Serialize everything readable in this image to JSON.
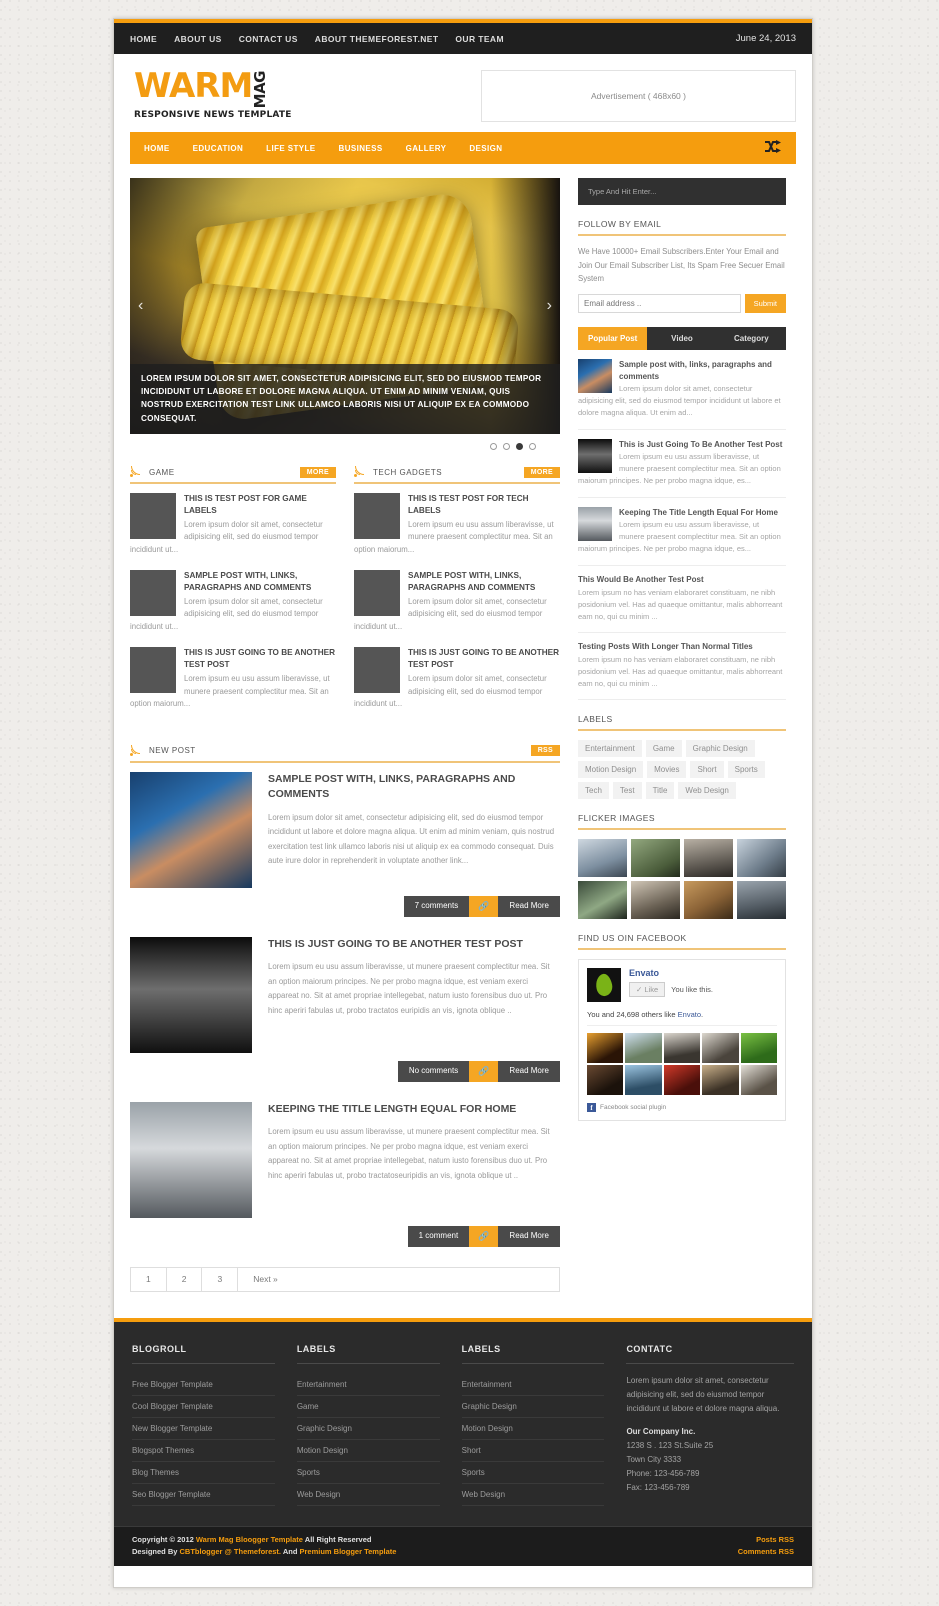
{
  "topbar": {
    "links": [
      "HOME",
      "ABOUT US",
      "CONTACT US",
      "ABOUT THEMEFOREST.NET",
      "OUR TEAM"
    ],
    "date": "June 24, 2013"
  },
  "logo": {
    "warm": "WARM",
    "mag": "MAG",
    "tagline": "RESPONSIVE NEWS TEMPLATE"
  },
  "ad": {
    "label": "Advertisement ( 468x60 )"
  },
  "mainnav": {
    "items": [
      "HOME",
      "EDUCATION",
      "LIFE STYLE",
      "BUSINESS",
      "GALLERY",
      "DESIGN"
    ],
    "shuffle_icon": "shuffle-icon"
  },
  "slider": {
    "caption": "LOREM IPSUM DOLOR SIT AMET, CONSECTETUR ADIPISICING ELIT, SED DO EIUSMOD TEMPOR INCIDIDUNT UT LABORE ET DOLORE MAGNA ALIQUA. UT ENIM AD MINIM VENIAM, QUIS NOSTRUD EXERCITATION TEST LINK ULLAMCO LABORIS NISI UT ALIQUIP EX EA COMMODO CONSEQUAT.",
    "prev": "‹",
    "next": "›",
    "dots": 4,
    "active_dot": 2
  },
  "categories": [
    {
      "title": "GAME",
      "more": "MORE",
      "posts": [
        {
          "title": "THIS IS TEST POST FOR GAME LABELS",
          "excerpt": "Lorem ipsum dolor sit amet, consectetur adipisicing elit, sed do eiusmod tempor incididunt ut...",
          "thumb": "tx1"
        },
        {
          "title": "SAMPLE POST WITH, LINKS, PARAGRAPHS AND COMMENTS",
          "excerpt": "Lorem ipsum dolor sit amet, consectetur adipisicing elit, sed do eiusmod tempor incididunt ut...",
          "thumb": "tx2"
        },
        {
          "title": "THIS IS JUST GOING TO BE ANOTHER TEST POST",
          "excerpt": "Lorem ipsum eu usu assum liberavisse, ut munere praesent complectitur mea. Sit an option maiorum...",
          "thumb": "tx3"
        }
      ]
    },
    {
      "title": "TECH GADGETS",
      "more": "MORE",
      "posts": [
        {
          "title": "THIS IS TEST POST FOR TECH LABELS",
          "excerpt": "Lorem ipsum eu usu assum liberavisse, ut munere praesent complectitur mea. Sit an option maiorum...",
          "thumb": "tx4"
        },
        {
          "title": "SAMPLE POST WITH, LINKS, PARAGRAPHS AND COMMENTS",
          "excerpt": "Lorem ipsum dolor sit amet, consectetur adipisicing elit, sed do eiusmod tempor incididunt ut...",
          "thumb": "tx5"
        },
        {
          "title": "THIS IS JUST GOING TO BE ANOTHER TEST POST",
          "excerpt": "Lorem ipsum dolor sit amet, consectetur adipisicing elit, sed do eiusmod tempor incididunt ut...",
          "thumb": "tx6"
        }
      ]
    }
  ],
  "newpost": {
    "title": "NEW POST",
    "rss_label": "RSS",
    "articles": [
      {
        "title": "SAMPLE POST WITH, LINKS, PARAGRAPHS AND COMMENTS",
        "excerpt": " Lorem ipsum dolor sit amet, consectetur adipisicing elit, sed do eiusmod tempor incididunt ut labore et dolore magna aliqua. Ut enim ad minim veniam, quis nostrud exercitation test link ullamco laboris nisi ut aliquip ex ea commodo consequat. Duis aute irure dolor in reprehenderit in voluptate another link...",
        "comments": "7 comments",
        "link_icon": "link-icon",
        "readmore": "Read More",
        "thumb": "bp1"
      },
      {
        "title": "THIS IS JUST GOING TO BE ANOTHER TEST POST",
        "excerpt": "Lorem ipsum eu usu assum liberavisse, ut munere praesent complectitur mea. Sit an option maiorum principes. Ne per probo magna idque, est veniam exerci appareat no. Sit at amet propriae intellegebat, natum iusto forensibus duo ut. Pro hinc aperiri fabulas ut, probo tractatos euripidis an vis, ignota oblique ..",
        "comments": "No comments",
        "link_icon": "link-icon",
        "readmore": "Read More",
        "thumb": "bp2"
      },
      {
        "title": "KEEPING THE TITLE LENGTH EQUAL FOR HOME",
        "excerpt": "Lorem ipsum eu usu assum liberavisse, ut munere praesent complectitur mea. Sit an option maiorum principes. Ne per probo magna idque, est veniam exerci appareat no. Sit at amet propriae intellegebat, natum iusto forensibus duo ut. Pro hinc aperiri fabulas ut, probo tractatoseuripidis an vis, ignota oblique ut ..",
        "comments": "1 comment",
        "link_icon": "link-icon",
        "readmore": "Read More",
        "thumb": "bp3"
      }
    ]
  },
  "pagination": [
    "1",
    "2",
    "3",
    "Next »"
  ],
  "sidebar": {
    "search_placeholder": "Type And Hit Enter...",
    "follow": {
      "title": "FOLLOW BY EMAIL",
      "desc": "We Have 10000+ Email Subscribers.Enter Your Email and Join Our Email Subscriber List, Its Spam Free Secuer Email System",
      "input_placeholder": "Email address ..",
      "submit": "Submit"
    },
    "tabs": [
      "Popular Post",
      "Video",
      "Category"
    ],
    "active_tab": 0,
    "popular": [
      {
        "title": "Sample post with, links, paragraphs and comments",
        "excerpt": "Lorem ipsum dolor sit amet, consectetur adipisicing elit, sed do eiusmod tempor incididunt ut labore et dolore magna aliqua. Ut enim ad...",
        "thumb": "bp1"
      },
      {
        "title": "This is Just Going To Be Another Test Post",
        "excerpt": "Lorem ipsum eu usu assum liberavisse, ut munere praesent complectitur mea. Sit an option maiorum principes. Ne per probo magna idque, es...",
        "thumb": "bp2"
      },
      {
        "title": "Keeping The Title Length Equal For Home",
        "excerpt": "Lorem ipsum eu usu assum liberavisse, ut munere praesent complectitur mea. Sit an option maiorum principes. Ne per probo magna idque, es...",
        "thumb": "bp3"
      }
    ],
    "popular_text": [
      {
        "title": "This Would Be Another Test Post",
        "excerpt": "Lorem ipsum no has veniam elaboraret constituam, ne nibh posidonium vel. Has ad quaeque omittantur, malis abhorreant eam no, qui cu minim ..."
      },
      {
        "title": "Testing Posts With Longer Than Normal Titles",
        "excerpt": "Lorem ipsum no has veniam elaboraret constituam, ne nibh posidonium vel. Has ad quaeque omittantur, malis abhorreant eam no, qui cu minim ..."
      }
    ],
    "labels": {
      "title": "LABELS",
      "tags": [
        "Entertainment",
        "Game",
        "Graphic Design",
        "Motion Design",
        "Movies",
        "Short",
        "Sports",
        "Tech",
        "Test",
        "Title",
        "Web Design"
      ]
    },
    "flicker": {
      "title": "FLICKER IMAGES",
      "count": 8
    },
    "facebook": {
      "title": "FIND US OIN FACEBOOK",
      "page_name": "Envato",
      "like_button": "✓ Like",
      "like_status": "You like this.",
      "sub_prefix": "You and 24,698 others like ",
      "sub_link": "Envato",
      "sub_suffix": ".",
      "plugin": "Facebook social plugin",
      "tile_count": 10
    }
  },
  "footer": {
    "columns": [
      {
        "title": "BLOGROLL",
        "links": [
          "Free Blogger Template",
          "Cool Blogger Template",
          "New Blogger Template",
          "Blogspot Themes",
          "Blog Themes",
          "Seo Blogger Template"
        ]
      },
      {
        "title": "LABELS",
        "links": [
          "Entertainment",
          "Game",
          "Graphic Design",
          "Motion Design",
          "Sports",
          "Web Design"
        ]
      },
      {
        "title": "LABELS",
        "links": [
          "Entertainment",
          "Graphic Design",
          "Motion Design",
          "Short",
          "Sports",
          "Web Design"
        ]
      }
    ],
    "contact": {
      "title": "CONTATC",
      "desc": "Lorem ipsum dolor sit amet, consectetur adipisicing elit, sed do eiusmod tempor incididunt ut labore et dolore magna aliqua.",
      "company": "Our Company Inc.",
      "address1": "1238 S . 123 St.Suite 25",
      "address2": "Town City 3333",
      "phone": "Phone: 123-456-789",
      "fax": "Fax: 123-456-789"
    },
    "bottom": {
      "line1_pre": "Copyright © 2012 ",
      "line1_link": "Warm Mag Bloogger Template",
      "line1_post": " All Right Reserved",
      "line2_pre": "Designed By ",
      "line2_link1": "CBTblogger @ Themeforest.",
      "line2_mid": " And ",
      "line2_link2": "Premium Blogger Template",
      "posts_rss": "Posts RSS",
      "comments_rss": "Comments RSS"
    }
  }
}
